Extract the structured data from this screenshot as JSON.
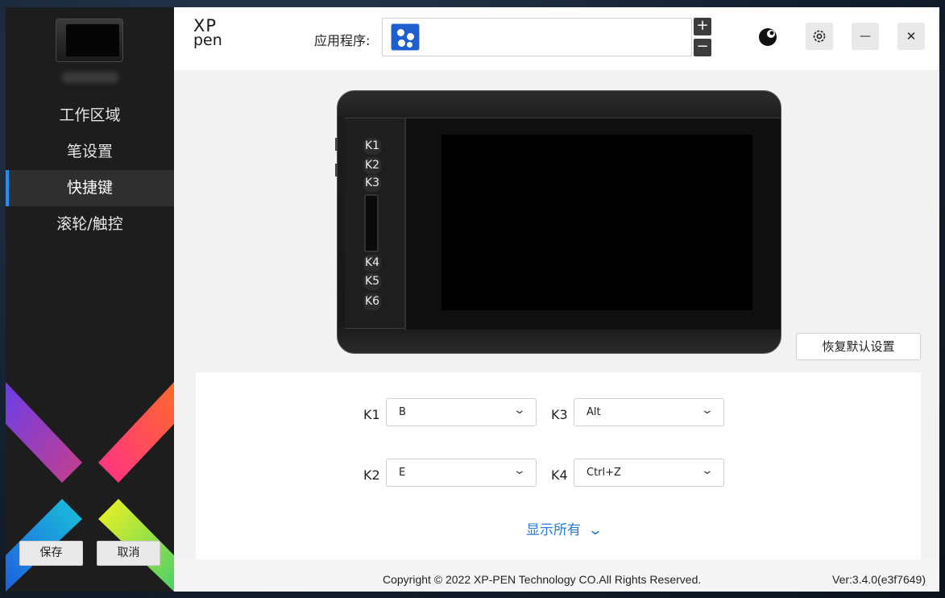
{
  "sidebar": {
    "nav": [
      {
        "label": "工作区域"
      },
      {
        "label": "笔设置"
      },
      {
        "label": "快捷键"
      },
      {
        "label": "滚轮/触控"
      }
    ],
    "active_index": 2,
    "save_label": "保存",
    "cancel_label": "取消"
  },
  "header": {
    "logo_line1": "XP",
    "logo_line2": "pen",
    "app_label": "应用程序:",
    "add_symbol": "+",
    "remove_symbol": "−",
    "minimize_symbol": "—",
    "close_symbol": "✕"
  },
  "tablet": {
    "keys": [
      "K1",
      "K2",
      "K3",
      "K4",
      "K5",
      "K6"
    ]
  },
  "restore_label": "恢复默认设置",
  "shortcuts": {
    "k1": {
      "label": "K1",
      "value": "B"
    },
    "k2": {
      "label": "K2",
      "value": "E"
    },
    "k3": {
      "label": "K3",
      "value": "Alt"
    },
    "k4": {
      "label": "K4",
      "value": "Ctrl+Z"
    },
    "show_all": "显示所有"
  },
  "footer": {
    "copyright": "Copyright © 2022  XP-PEN Technology CO.All Rights Reserved.",
    "version": "Ver:3.4.0(e3f7649)"
  },
  "colors": {
    "accent": "#1890ff",
    "link": "#2a7ad6",
    "sidebar_bg": "#1d1d1d"
  }
}
